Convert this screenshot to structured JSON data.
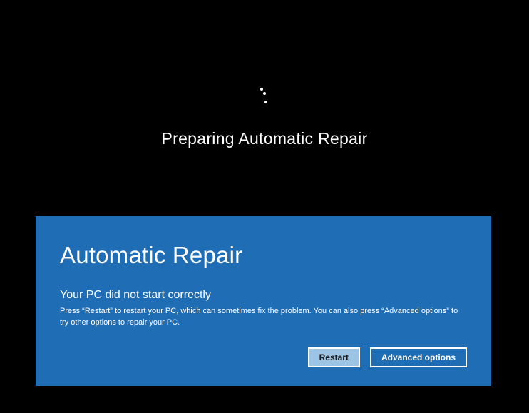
{
  "boot": {
    "status_text": "Preparing Automatic Repair"
  },
  "recovery": {
    "title": "Automatic Repair",
    "subtitle": "Your PC did not start correctly",
    "body": "Press “Restart” to restart your PC, which can sometimes fix the problem. You can also press “Advanced options” to try other options to repair your PC.",
    "buttons": {
      "restart": "Restart",
      "advanced": "Advanced options"
    }
  },
  "colors": {
    "background": "#000000",
    "panel": "#1f6db5",
    "button_primary_bg": "#9cc4e4"
  }
}
